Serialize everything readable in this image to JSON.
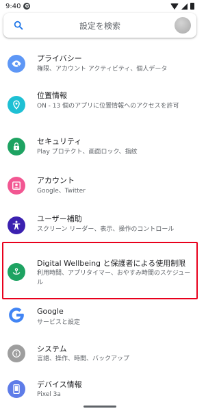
{
  "status": {
    "time": "9:40",
    "badge": "G"
  },
  "search": {
    "placeholder": "設定を検索"
  },
  "items": [
    {
      "title": "プライバシー",
      "subtitle": "権限、アカウント アクティビティ、個人データ",
      "color": "#5e97f6",
      "icon": "privacy-eye-icon"
    },
    {
      "title": "位置情報",
      "subtitle": "ON - 13 個のアプリに位置情報へのアクセスを許可",
      "color": "#1ec0d4",
      "icon": "location-pin-icon"
    },
    {
      "title": "セキュリティ",
      "subtitle": "Play プロテクト、画面ロック、指紋",
      "color": "#1ea362",
      "icon": "lock-icon"
    },
    {
      "title": "アカウント",
      "subtitle": "Google、Twitter",
      "color": "#f25792",
      "icon": "account-box-icon"
    },
    {
      "title": "ユーザー補助",
      "subtitle": "スクリーン リーダー、表示、操作のコントロール",
      "color": "#3b21b0",
      "icon": "accessibility-icon"
    },
    {
      "title": "Digital Wellbeing と保護者による使用制限",
      "subtitle": "利用時間、アプリタイマー、おやすみ時間のスケジュール",
      "color": "#1ea362",
      "icon": "wellbeing-icon"
    },
    {
      "title": "Google",
      "subtitle": "サービスと設定",
      "color": "#4285f4",
      "icon": "google-g-icon"
    },
    {
      "title": "システム",
      "subtitle": "言語、操作、時間、バックアップ",
      "color": "#9e9e9e",
      "icon": "info-icon"
    },
    {
      "title": "デバイス情報",
      "subtitle": "Pixel 3a",
      "color": "#5e7ce8",
      "icon": "phone-icon"
    }
  ],
  "colors": {
    "accent": "#1a73e8",
    "highlight": "#e8001c"
  }
}
